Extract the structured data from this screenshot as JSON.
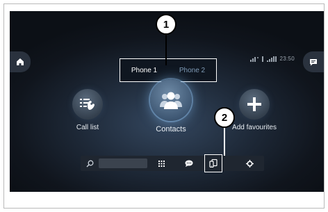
{
  "status_bar": {
    "time": "23:50"
  },
  "phone_switch": {
    "phone1": "Phone 1",
    "phone2": "Phone 2"
  },
  "features": {
    "call_list": "Call list",
    "contacts": "Contacts",
    "add_favourites": "Add favourites"
  },
  "callouts": {
    "one": "1",
    "two": "2"
  },
  "dock": {
    "icons": [
      "search-icon",
      "keypad-icon",
      "message-icon",
      "device-transfer-icon",
      "settings-icon"
    ]
  },
  "colors": {
    "screen_bg": "#10151d",
    "accent": "#6e8aa6",
    "inactive_text": "#7f9bb6"
  }
}
